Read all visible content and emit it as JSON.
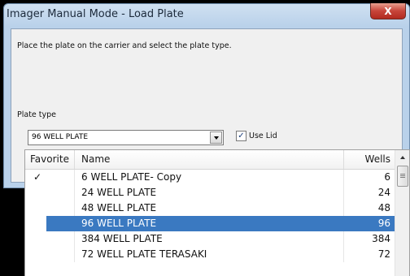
{
  "window": {
    "title": "Imager Manual Mode - Load Plate",
    "close_label": "X"
  },
  "dialog": {
    "instruction": "Place the plate on the carrier and select the plate type.",
    "plate_type_label": "Plate type",
    "plate_type_value": "96 WELL PLATE",
    "use_lid_label": "Use Lid",
    "use_lid_checked": true,
    "check_mark": "✓"
  },
  "plate_list": {
    "columns": {
      "favorite": "Favorite",
      "name": "Name",
      "wells": "Wells"
    },
    "rows": [
      {
        "favorite": "✓",
        "name": "6 WELL PLATE- Copy",
        "wells": "6",
        "selected": false
      },
      {
        "favorite": "",
        "name": "24 WELL PLATE",
        "wells": "24",
        "selected": false
      },
      {
        "favorite": "",
        "name": "48 WELL PLATE",
        "wells": "48",
        "selected": false
      },
      {
        "favorite": "",
        "name": "96 WELL PLATE",
        "wells": "96",
        "selected": true
      },
      {
        "favorite": "",
        "name": "384 WELL PLATE",
        "wells": "384",
        "selected": false
      },
      {
        "favorite": "",
        "name": "72 WELL PLATE TERASAKI",
        "wells": "72",
        "selected": false
      }
    ]
  },
  "colors": {
    "selection": "#3a79c1",
    "title_bar": "#b9d1ea",
    "close_button": "#c7453a"
  }
}
